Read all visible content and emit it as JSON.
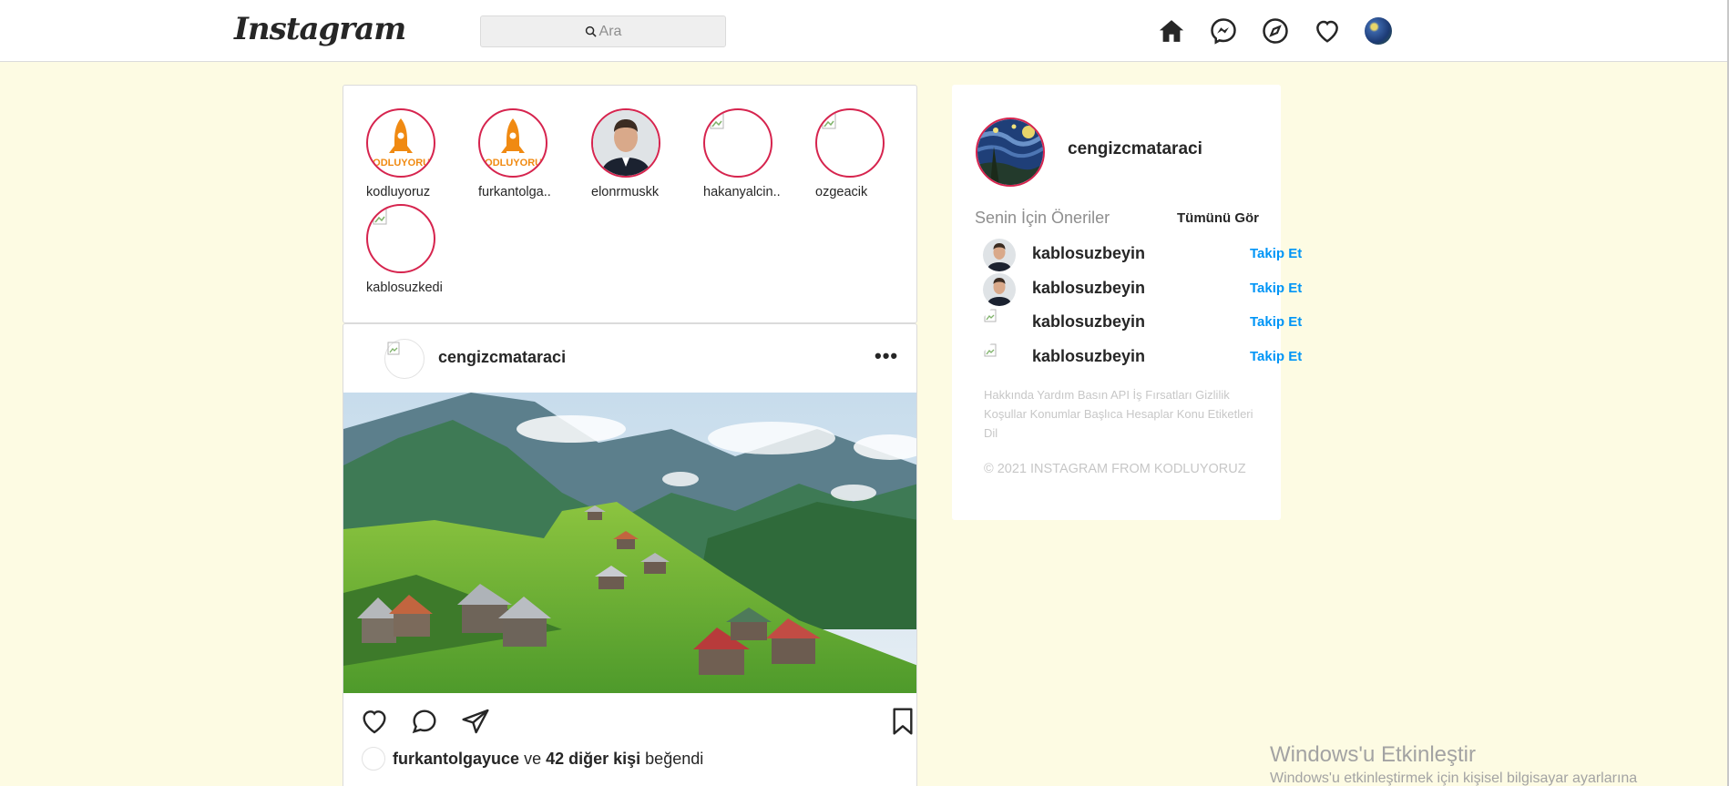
{
  "header": {
    "logo_text": "Instagram",
    "search_placeholder": "Ara",
    "nav_icons": [
      "home-icon",
      "messenger-icon",
      "explore-icon",
      "heart-icon",
      "profile-avatar"
    ]
  },
  "stories": [
    {
      "name": "kodluyoruz",
      "image": "rocket-logo"
    },
    {
      "name": "furkantolga..",
      "image": "rocket-logo"
    },
    {
      "name": "elonrmuskk",
      "image": "portrait"
    },
    {
      "name": "hakanyalcin..",
      "image": "broken"
    },
    {
      "name": "ozgeacik",
      "image": "broken"
    },
    {
      "name": "kablosuzkedi",
      "image": "broken"
    }
  ],
  "post": {
    "username": "cengizcmataraci",
    "more": "•••",
    "likes": {
      "first_user": "furkantolgayuce",
      "and": "ve",
      "others": "42 diğer kişi",
      "liked": "beğendi"
    }
  },
  "sidebar": {
    "username": "cengizcmataraci",
    "suggestions_title": "Senin İçin Öneriler",
    "see_all": "Tümünü Gör",
    "suggestions": [
      {
        "name": "kablosuzbeyin",
        "action": "Takip Et",
        "avatar": "portrait"
      },
      {
        "name": "kablosuzbeyin",
        "action": "Takip Et",
        "avatar": "portrait"
      },
      {
        "name": "kablosuzbeyin",
        "action": "Takip Et",
        "avatar": "broken"
      },
      {
        "name": "kablosuzbeyin",
        "action": "Takip Et",
        "avatar": "broken"
      }
    ],
    "footer_links": "Hakkında Yardım Basın API İş Fırsatları Gizlilik Koşullar Konumlar Başlıca Hesaplar Konu Etiketleri Dil",
    "copyright": "© 2021 INSTAGRAM FROM KODLUYORUZ"
  },
  "watermark": {
    "title": "Windows'u Etkinleştir",
    "subtitle": "Windows'u etkinleştirmek için kişisel bilgisayar ayarlarına"
  },
  "colors": {
    "background": "#fdfbe3",
    "story_ring": "#d6244e",
    "follow_blue": "#0095f6"
  }
}
